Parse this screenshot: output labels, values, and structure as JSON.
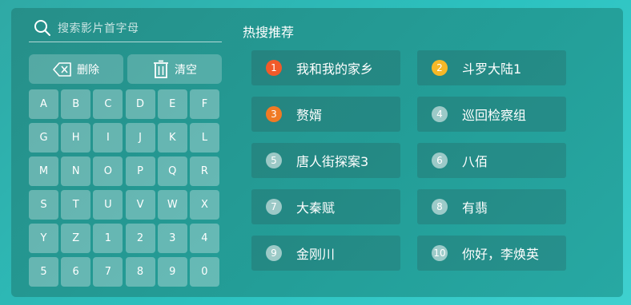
{
  "search": {
    "placeholder": "搜索影片首字母",
    "icon": "search-icon"
  },
  "actions": {
    "delete_label": "删除",
    "clear_label": "清空"
  },
  "keyboard": {
    "keys": [
      "A",
      "B",
      "C",
      "D",
      "E",
      "F",
      "G",
      "H",
      "I",
      "J",
      "K",
      "L",
      "M",
      "N",
      "O",
      "P",
      "Q",
      "R",
      "S",
      "T",
      "U",
      "V",
      "W",
      "X",
      "Y",
      "Z",
      "1",
      "2",
      "3",
      "4",
      "5",
      "6",
      "7",
      "8",
      "9",
      "0"
    ]
  },
  "hot": {
    "title": "热搜推荐",
    "items": [
      {
        "rank": "1",
        "title": "我和我的家乡",
        "badge_color": "#f15a2a"
      },
      {
        "rank": "2",
        "title": "斗罗大陆1",
        "badge_color": "#f7b827"
      },
      {
        "rank": "3",
        "title": "赘婿",
        "badge_color": "#f07a24"
      },
      {
        "rank": "4",
        "title": "巡回检察组",
        "badge_color": "#b9d8d6"
      },
      {
        "rank": "5",
        "title": "唐人街探案3",
        "badge_color": "#b9d8d6"
      },
      {
        "rank": "6",
        "title": "八佰",
        "badge_color": "#b9d8d6"
      },
      {
        "rank": "7",
        "title": "大秦赋",
        "badge_color": "#b9d8d6"
      },
      {
        "rank": "8",
        "title": "有翡",
        "badge_color": "#b9d8d6"
      },
      {
        "rank": "9",
        "title": "金刚川",
        "badge_color": "#b9d8d6"
      },
      {
        "rank": "10",
        "title": "你好，李焕英",
        "badge_color": "#b9d8d6"
      }
    ]
  }
}
